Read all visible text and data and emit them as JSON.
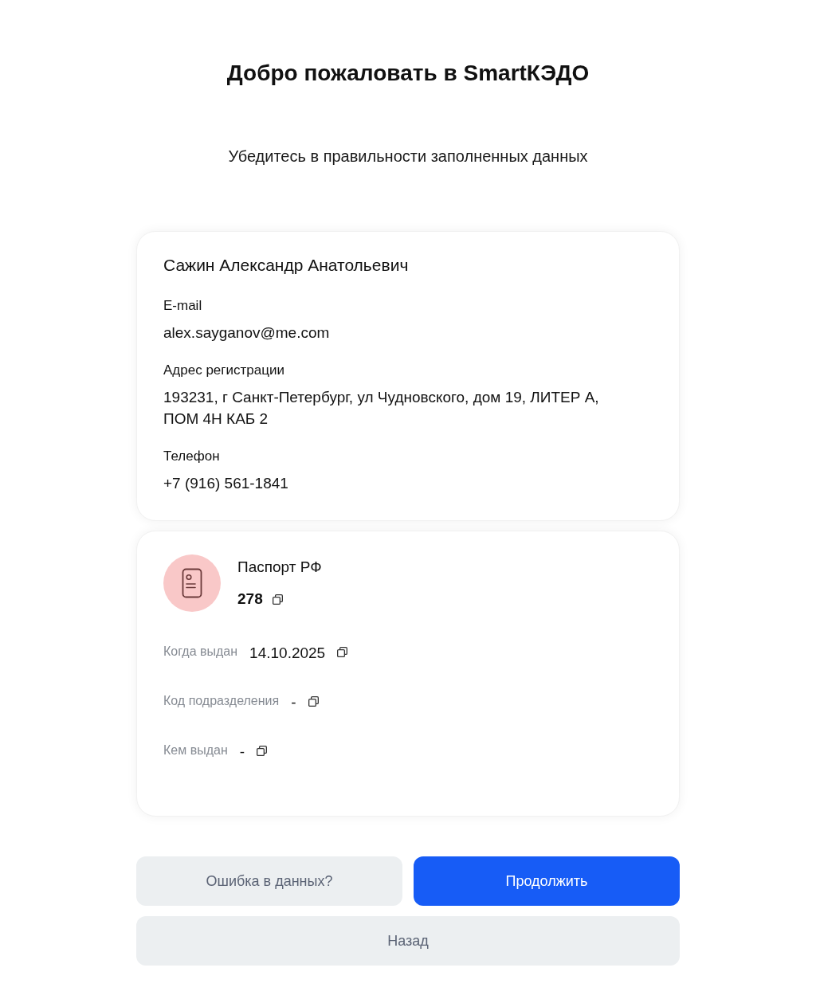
{
  "header": {
    "title": "Добро пожаловать в SmartКЭДО",
    "subtitle": "Убедитесь в правильности заполненных данных"
  },
  "profile": {
    "name": "Сажин Александр Анатольевич",
    "fields": [
      {
        "label": "E-mail",
        "value": "alex.sayganov@me.com"
      },
      {
        "label": "Адрес регистрации",
        "value": "193231, г Санкт-Петербург, ул Чудновского, дом 19, ЛИТЕР А, ПОМ 4Н КАБ 2"
      },
      {
        "label": "Телефон",
        "value": "+7 (916) 561-1841"
      }
    ]
  },
  "document": {
    "title": "Паспорт РФ",
    "number": "278",
    "fields": [
      {
        "label": "Когда выдан",
        "value": "14.10.2025"
      },
      {
        "label": "Код подразделения",
        "value": "-"
      },
      {
        "label": "Кем выдан",
        "value": "-"
      }
    ]
  },
  "actions": {
    "rows": [
      {
        "buttons": [
          {
            "label": "Ошибка в данных?",
            "kind": "secondary"
          },
          {
            "label": "Продолжить",
            "kind": "primary"
          }
        ]
      },
      {
        "buttons": [
          {
            "label": "Назад",
            "kind": "secondary"
          }
        ]
      }
    ]
  }
}
